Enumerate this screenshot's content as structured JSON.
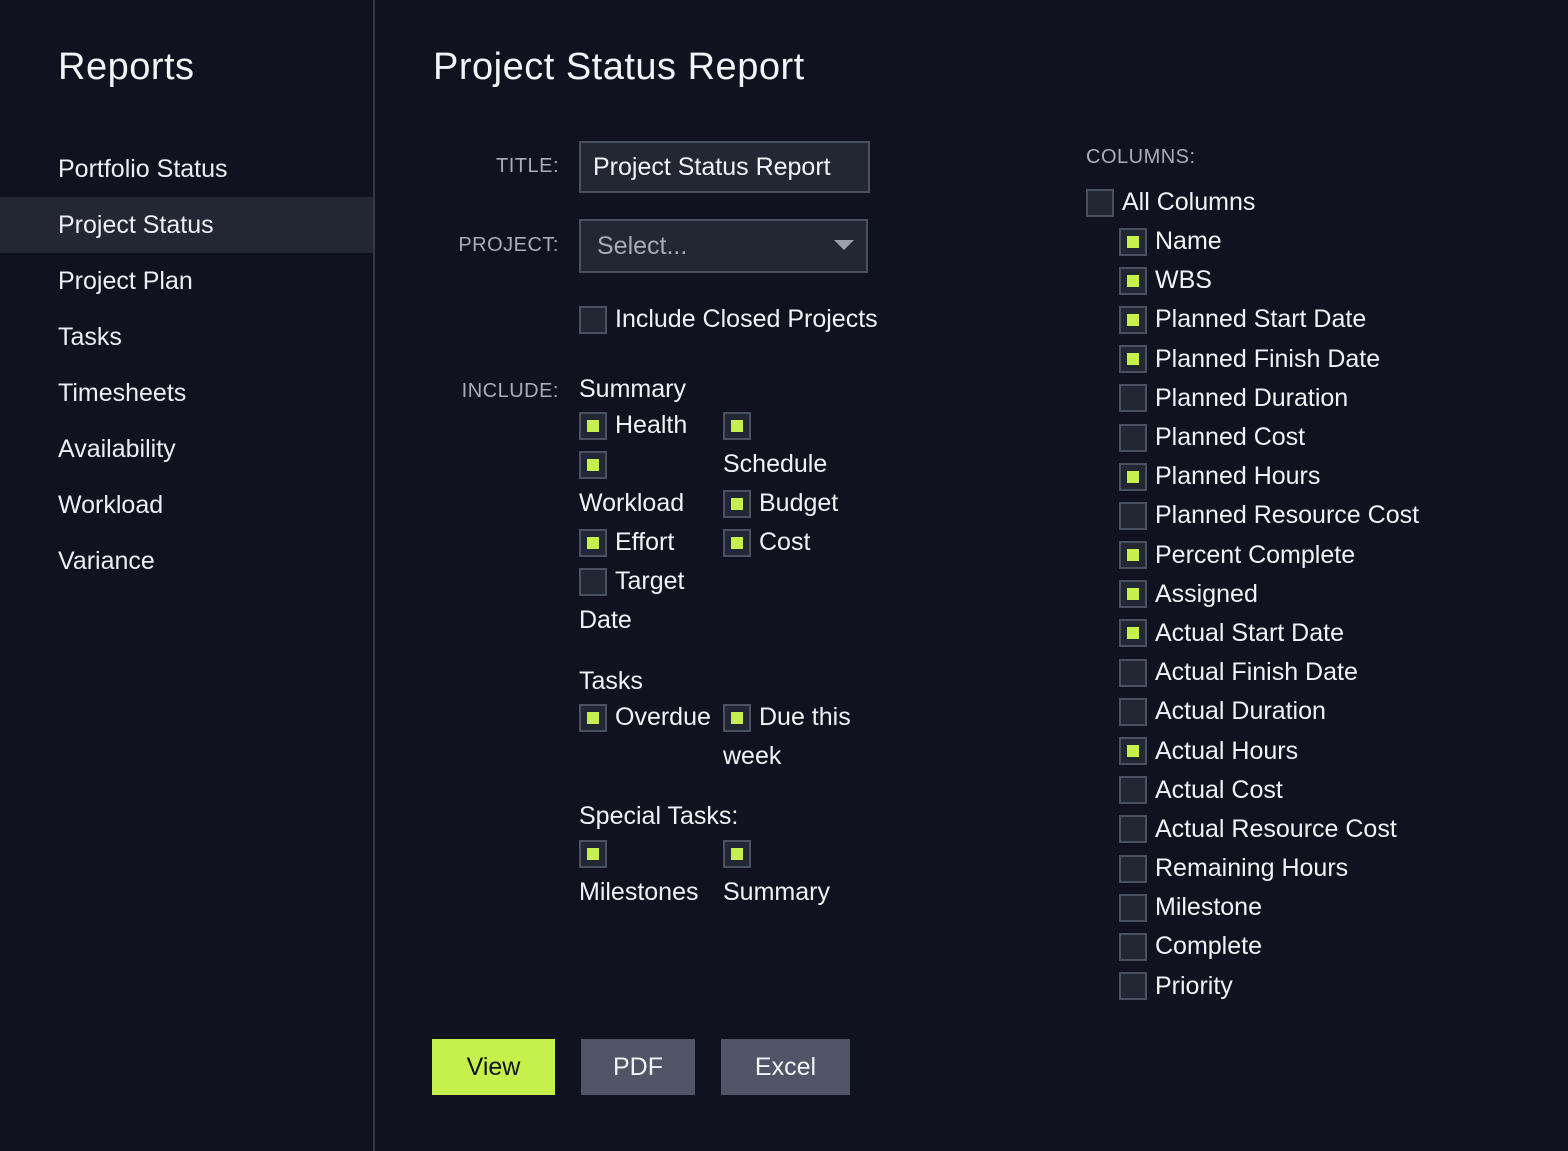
{
  "sidebar": {
    "title": "Reports",
    "items": [
      {
        "label": "Portfolio Status",
        "active": false
      },
      {
        "label": "Project Status",
        "active": true
      },
      {
        "label": "Project Plan",
        "active": false
      },
      {
        "label": "Tasks",
        "active": false
      },
      {
        "label": "Timesheets",
        "active": false
      },
      {
        "label": "Availability",
        "active": false
      },
      {
        "label": "Workload",
        "active": false
      },
      {
        "label": "Variance",
        "active": false
      }
    ]
  },
  "main": {
    "page_title": "Project Status Report",
    "form": {
      "title_label": "TITLE:",
      "title_value": "Project Status Report",
      "project_label": "PROJECT:",
      "project_placeholder": "Select...",
      "include_closed": {
        "label": "Include Closed Projects",
        "checked": false
      },
      "include_label": "INCLUDE:",
      "summary": {
        "heading": "Summary",
        "options": [
          {
            "label": "Health",
            "checked": true
          },
          {
            "label": "Schedule",
            "checked": true
          },
          {
            "label": "Workload",
            "checked": true
          },
          {
            "label": "Budget",
            "checked": true
          },
          {
            "label": "Effort",
            "checked": true
          },
          {
            "label": "Cost",
            "checked": true
          },
          {
            "label": "Target Date",
            "checked": false
          }
        ],
        "target_line1": "Target",
        "target_line2": "Date"
      },
      "tasks": {
        "heading": "Tasks",
        "options": [
          {
            "label": "Overdue",
            "checked": true
          },
          {
            "label": "Due this week",
            "checked": true
          }
        ],
        "due_line1": "Due this",
        "due_line2": "week"
      },
      "special_tasks": {
        "heading": "Special Tasks:",
        "options": [
          {
            "label": "Milestones",
            "checked": true
          },
          {
            "label": "Summary",
            "checked": true
          }
        ]
      }
    },
    "columns": {
      "label": "COLUMNS:",
      "all_columns": {
        "label": "All Columns",
        "checked": false
      },
      "items": [
        {
          "label": "Name",
          "checked": true
        },
        {
          "label": "WBS",
          "checked": true
        },
        {
          "label": "Planned Start Date",
          "checked": true
        },
        {
          "label": "Planned Finish Date",
          "checked": true
        },
        {
          "label": "Planned Duration",
          "checked": false
        },
        {
          "label": "Planned Cost",
          "checked": false
        },
        {
          "label": "Planned Hours",
          "checked": true
        },
        {
          "label": "Planned Resource Cost",
          "checked": false
        },
        {
          "label": "Percent Complete",
          "checked": true
        },
        {
          "label": "Assigned",
          "checked": true
        },
        {
          "label": "Actual Start Date",
          "checked": true
        },
        {
          "label": "Actual Finish Date",
          "checked": false
        },
        {
          "label": "Actual Duration",
          "checked": false
        },
        {
          "label": "Actual Hours",
          "checked": true
        },
        {
          "label": "Actual Cost",
          "checked": false
        },
        {
          "label": "Actual Resource Cost",
          "checked": false
        },
        {
          "label": "Remaining Hours",
          "checked": false
        },
        {
          "label": "Milestone",
          "checked": false
        },
        {
          "label": "Complete",
          "checked": false
        },
        {
          "label": "Priority",
          "checked": false
        }
      ]
    },
    "buttons": {
      "view": "View",
      "pdf": "PDF",
      "excel": "Excel"
    }
  },
  "colors": {
    "background": "#10131f",
    "accent": "#c6f04b",
    "input_bg": "#232734",
    "button_secondary": "#4f5566"
  }
}
